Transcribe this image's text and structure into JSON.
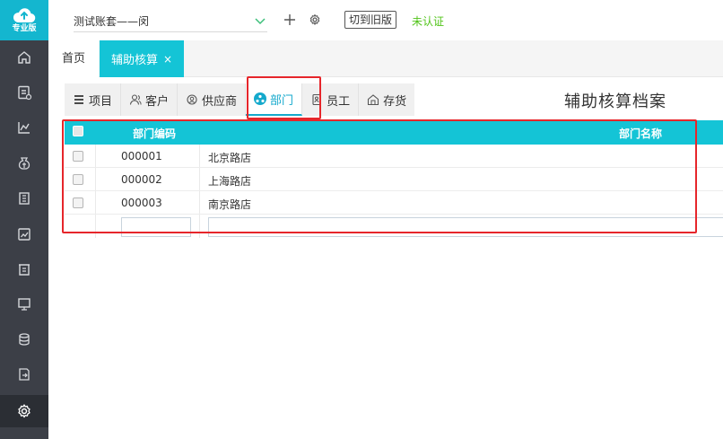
{
  "logo": {
    "text": "专业版"
  },
  "header": {
    "account_name": "测试账套——闵",
    "old_version_label": "切到旧版",
    "cert_status": "未认证",
    "cert_color": "#52c41a"
  },
  "tabs": [
    {
      "label": "首页"
    },
    {
      "label": "辅助核算",
      "close": "×"
    }
  ],
  "categories": [
    {
      "label": "项目",
      "icon": "list-icon"
    },
    {
      "label": "客户",
      "icon": "user-icon"
    },
    {
      "label": "供应商",
      "icon": "supplier-icon"
    },
    {
      "label": "部门",
      "icon": "department-icon",
      "selected": true
    },
    {
      "label": "员工",
      "icon": "employee-icon"
    },
    {
      "label": "存货",
      "icon": "inventory-icon"
    }
  ],
  "page_title": "辅助核算档案",
  "table": {
    "columns": [
      "部门编码",
      "部门名称"
    ],
    "rows": [
      {
        "code": "000001",
        "name": "北京路店"
      },
      {
        "code": "000002",
        "name": "上海路店"
      },
      {
        "code": "000003",
        "name": "南京路店"
      }
    ]
  },
  "colors": {
    "accent": "#14c4d6",
    "sidebar": "#3c3f47",
    "highlight": "#e6262b"
  }
}
